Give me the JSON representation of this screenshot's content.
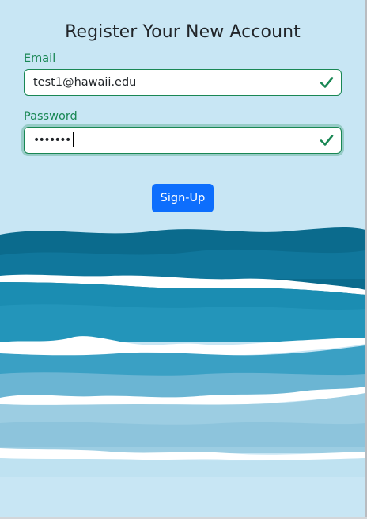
{
  "form": {
    "title": "Register Your New Account",
    "email": {
      "label": "Email",
      "value": "test1@hawaii.edu",
      "valid": true
    },
    "password": {
      "label": "Password",
      "masked_value": "•••••••",
      "length": 7,
      "valid": true,
      "focused": true
    },
    "submit_label": "Sign-Up"
  },
  "icons": {
    "email_status": "check-icon",
    "password_status": "check-icon"
  },
  "colors": {
    "page_background": "#c8e6f4",
    "valid_green": "#198754",
    "primary_blue": "#0d6efd",
    "title_text": "#212529",
    "wave_deep": "#0b6b8d",
    "wave_mid": "#1b8db2",
    "wave_light": "#6bb5d3",
    "foam": "#ffffff"
  },
  "background": {
    "image": "ocean-waves"
  }
}
